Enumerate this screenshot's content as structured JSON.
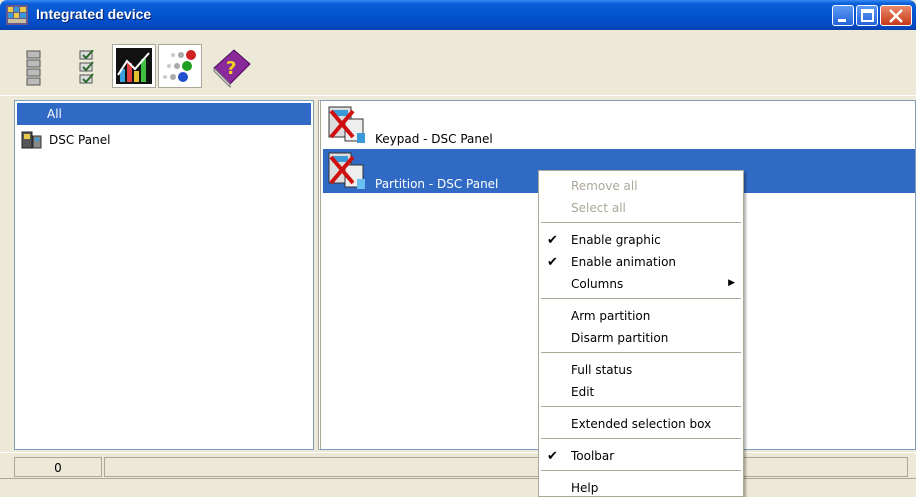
{
  "window": {
    "title": "Integrated device"
  },
  "tree": {
    "items": [
      {
        "label": "All"
      },
      {
        "label": "DSC Panel"
      }
    ]
  },
  "list": {
    "rows": [
      {
        "label": "Keypad - DSC Panel"
      },
      {
        "label": "Partition - DSC Panel"
      }
    ]
  },
  "status": {
    "cell1": "0"
  },
  "context_menu": {
    "remove_all": "Remove all",
    "select_all": "Select all",
    "enable_graphic": "Enable graphic",
    "enable_animation": "Enable animation",
    "columns": "Columns",
    "arm_partition": "Arm partition",
    "disarm_partition": "Disarm partition",
    "full_status": "Full status",
    "edit": "Edit",
    "extended_selection_box": "Extended selection box",
    "toolbar": "Toolbar",
    "help": "Help"
  },
  "colors": {
    "titlebar": "#0553D0",
    "selection": "#316AC5",
    "window_bg": "#ECE9D8"
  }
}
